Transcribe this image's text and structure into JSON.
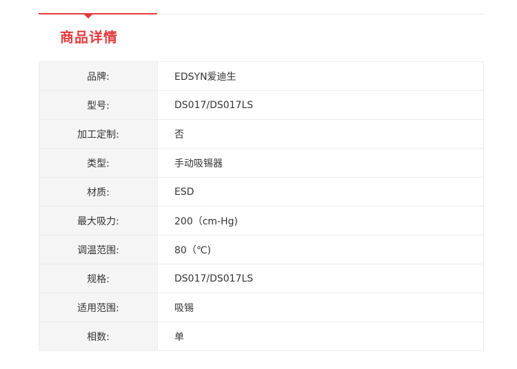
{
  "section": {
    "title": "商品详情",
    "accent_color": "#e4393c"
  },
  "specs": [
    {
      "label": "品牌:",
      "value": "EDSYN爱迪生"
    },
    {
      "label": "型号:",
      "value": "DS017/DS017LS"
    },
    {
      "label": "加工定制:",
      "value": "否"
    },
    {
      "label": "类型:",
      "value": "手动吸锡器"
    },
    {
      "label": "材质:",
      "value": "ESD"
    },
    {
      "label": "最大吸力:",
      "value": "200（cm-Hg)"
    },
    {
      "label": "调温范围:",
      "value": "80（℃)"
    },
    {
      "label": "规格:",
      "value": "DS017/DS017LS"
    },
    {
      "label": "适用范围:",
      "value": "吸锡"
    },
    {
      "label": "相数:",
      "value": "单"
    }
  ]
}
